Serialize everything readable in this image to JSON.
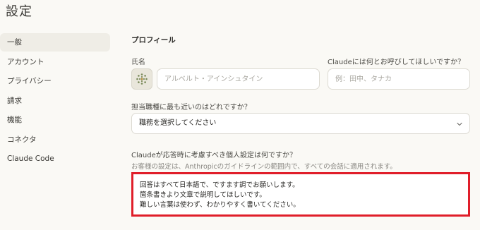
{
  "page": {
    "title": "設定"
  },
  "sidebar": {
    "items": [
      {
        "label": "一般",
        "active": true
      },
      {
        "label": "アカウント",
        "active": false
      },
      {
        "label": "プライバシー",
        "active": false
      },
      {
        "label": "請求",
        "active": false
      },
      {
        "label": "機能",
        "active": false
      },
      {
        "label": "コネクタ",
        "active": false
      },
      {
        "label": "Claude Code",
        "active": false
      }
    ]
  },
  "profile": {
    "section_title": "プロフィール",
    "full_name": {
      "label": "氏名",
      "placeholder": "アルベルト・アインシュタイン",
      "value": ""
    },
    "nickname": {
      "label": "Claudeには何とお呼びしてほしいですか？",
      "placeholder": "例：田中、タナカ",
      "value": ""
    },
    "role": {
      "label": "担当職種に最も近いのはどれですか？",
      "selected": "職務を選択してください"
    },
    "preferences": {
      "label": "Claudeが応答時に考慮すべき個人設定は何ですか？",
      "sublabel": "お客様の設定は、Anthropicのガイドラインの範囲内で、すべての会話に適用されます。",
      "lines": [
        "回答はすべて日本語で、ですます調でお願いします。",
        "箇条書きより文章で説明してほしいです。",
        "難しい言葉は使わず、わかりやすく書いてください。"
      ]
    }
  },
  "colors": {
    "background": "#faf9f5",
    "active_item": "#efede6",
    "highlight_border": "#e01e2a",
    "avatar_icon": "#7a8a5a"
  },
  "icons": {
    "avatar": "flower-avatar-icon",
    "select": "chevron-down-icon"
  }
}
